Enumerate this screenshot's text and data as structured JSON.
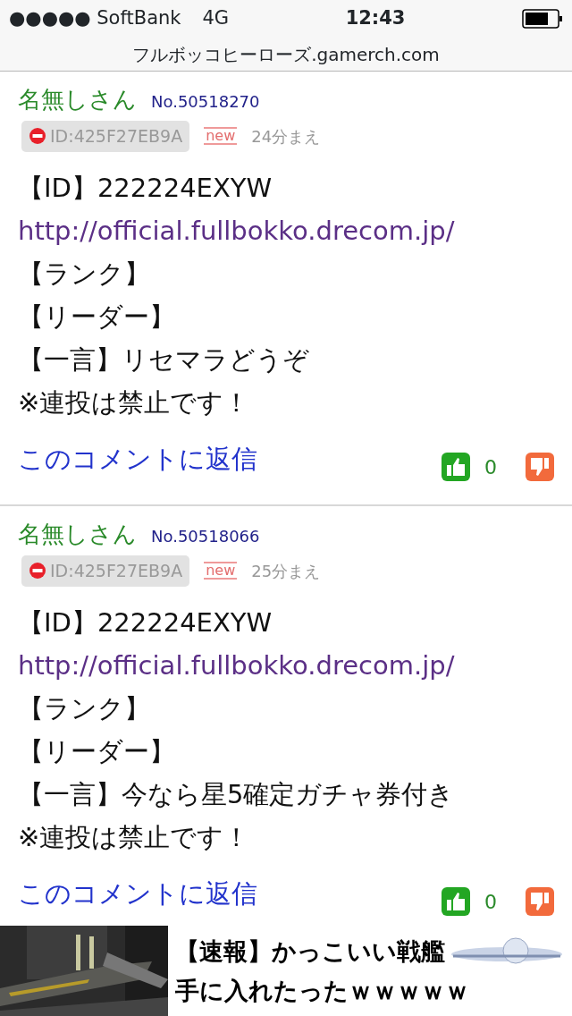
{
  "status_bar": {
    "carrier": "●●●●● SoftBank",
    "network": "4G",
    "time": "12:43"
  },
  "address_bar": {
    "title": "フルボッコヒーローズ.gamerch.com"
  },
  "comments": [
    {
      "author": "名無しさん",
      "number": "No.50518270",
      "user_id": "ID:425F27EB9A",
      "badge": "new",
      "time": "24分まえ",
      "lines": [
        {
          "kind": "text",
          "text": "【ID】222224EXYW"
        },
        {
          "kind": "link",
          "text": "http://official.fullbokko.drecom.jp/"
        },
        {
          "kind": "text",
          "text": "【ランク】"
        },
        {
          "kind": "text",
          "text": "【リーダー】"
        },
        {
          "kind": "text",
          "text": "【一言】リセマラどうぞ"
        },
        {
          "kind": "text",
          "text": "※連投は禁止です！"
        }
      ],
      "reply": "このコメントに返信",
      "likes": "0"
    },
    {
      "author": "名無しさん",
      "number": "No.50518066",
      "user_id": "ID:425F27EB9A",
      "badge": "new",
      "time": "25分まえ",
      "lines": [
        {
          "kind": "text",
          "text": "【ID】222224EXYW"
        },
        {
          "kind": "link",
          "text": "http://official.fullbokko.drecom.jp/"
        },
        {
          "kind": "text",
          "text": "【ランク】"
        },
        {
          "kind": "text",
          "text": "【リーダー】"
        },
        {
          "kind": "text",
          "text": "【一言】今なら星5確定ガチャ券付き"
        },
        {
          "kind": "text",
          "text": "※連投は禁止です！"
        }
      ],
      "reply": "このコメントに返信",
      "likes": "0"
    }
  ],
  "ad": {
    "headline_1": "【速報】かっこいい戦艦",
    "headline_2": "手に入れたったｗｗｗｗｗ"
  }
}
